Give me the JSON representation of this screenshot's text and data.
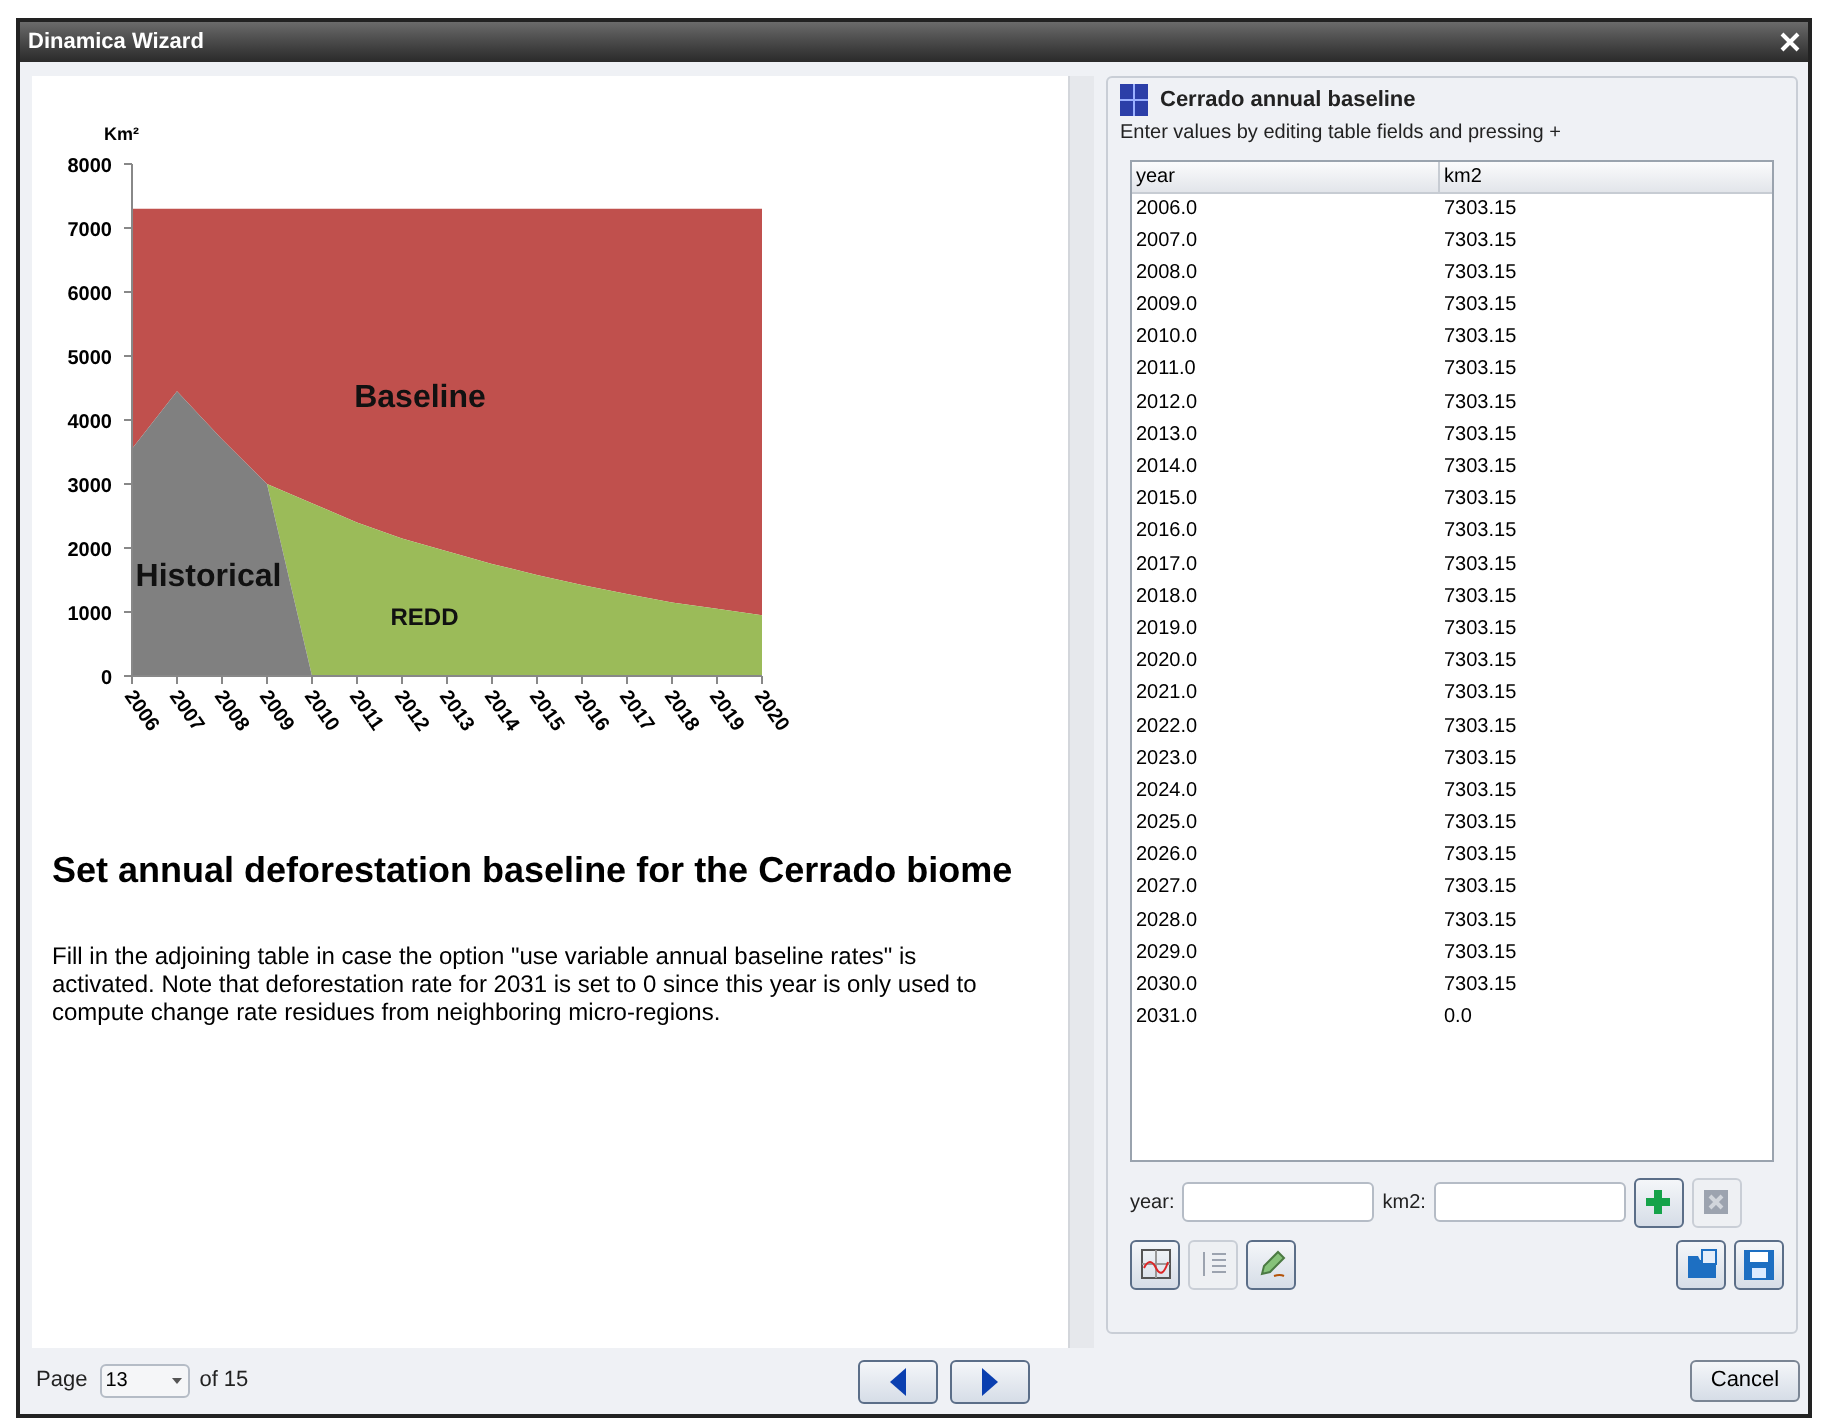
{
  "window": {
    "title": "Dinamica Wizard"
  },
  "chart_data": {
    "type": "area",
    "ylabel": "Km²",
    "categories": [
      "2006",
      "2007",
      "2008",
      "2009",
      "2010",
      "2011",
      "2012",
      "2013",
      "2014",
      "2015",
      "2016",
      "2017",
      "2018",
      "2019",
      "2020"
    ],
    "series": [
      {
        "name": "Baseline",
        "color": "#c0504d",
        "values": [
          7300,
          7300,
          7300,
          7300,
          7300,
          7300,
          7300,
          7300,
          7300,
          7300,
          7300,
          7300,
          7300,
          7300,
          7300
        ]
      },
      {
        "name": "REDD",
        "color": "#9bbb59",
        "values": [
          null,
          null,
          null,
          3000,
          2700,
          2400,
          2150,
          1950,
          1750,
          1580,
          1420,
          1280,
          1150,
          1050,
          950
        ]
      },
      {
        "name": "Historical",
        "color": "#808080",
        "values": [
          3550,
          4450,
          3700,
          3000,
          0,
          null,
          null,
          null,
          null,
          null,
          null,
          null,
          null,
          null,
          null
        ]
      }
    ],
    "ylim": [
      0,
      8000
    ],
    "yticks": [
      0,
      1000,
      2000,
      3000,
      4000,
      5000,
      6000,
      7000,
      8000
    ]
  },
  "heading": "Set annual deforestation baseline for the Cerrado biome",
  "description": "Fill in the adjoining table in case the option \"use variable annual baseline rates\" is activated. Note that deforestation rate for 2031 is set to 0 since this year is only used to compute change rate residues from neighboring micro-regions.",
  "panel": {
    "title": "Cerrado annual baseline",
    "hint": "Enter values by editing table fields and pressing +",
    "columns": [
      "year",
      "km2"
    ],
    "rows": [
      [
        "2006.0",
        "7303.15"
      ],
      [
        "2007.0",
        "7303.15"
      ],
      [
        "2008.0",
        "7303.15"
      ],
      [
        "2009.0",
        "7303.15"
      ],
      [
        "2010.0",
        "7303.15"
      ],
      [
        "2011.0",
        "7303.15"
      ],
      [
        "2012.0",
        "7303.15"
      ],
      [
        "2013.0",
        "7303.15"
      ],
      [
        "2014.0",
        "7303.15"
      ],
      [
        "2015.0",
        "7303.15"
      ],
      [
        "2016.0",
        "7303.15"
      ],
      [
        "2017.0",
        "7303.15"
      ],
      [
        "2018.0",
        "7303.15"
      ],
      [
        "2019.0",
        "7303.15"
      ],
      [
        "2020.0",
        "7303.15"
      ],
      [
        "2021.0",
        "7303.15"
      ],
      [
        "2022.0",
        "7303.15"
      ],
      [
        "2023.0",
        "7303.15"
      ],
      [
        "2024.0",
        "7303.15"
      ],
      [
        "2025.0",
        "7303.15"
      ],
      [
        "2026.0",
        "7303.15"
      ],
      [
        "2027.0",
        "7303.15"
      ],
      [
        "2028.0",
        "7303.15"
      ],
      [
        "2029.0",
        "7303.15"
      ],
      [
        "2030.0",
        "7303.15"
      ],
      [
        "2031.0",
        "0.0"
      ]
    ],
    "fields": [
      {
        "label": "year:"
      },
      {
        "label": "km2:"
      }
    ],
    "entry_buttons": [
      {
        "kind": "add",
        "disabled": false
      },
      {
        "kind": "remove",
        "disabled": true
      }
    ],
    "tool_buttons": [
      {
        "kind": "chart",
        "disabled": false
      },
      {
        "kind": "list",
        "disabled": true
      },
      {
        "kind": "edit",
        "disabled": false
      }
    ],
    "file_buttons": [
      {
        "kind": "open",
        "disabled": false
      },
      {
        "kind": "save",
        "disabled": false
      }
    ]
  },
  "footer": {
    "page_label": "Page",
    "page": "13",
    "page_total": "of 15",
    "cancel": "Cancel"
  }
}
